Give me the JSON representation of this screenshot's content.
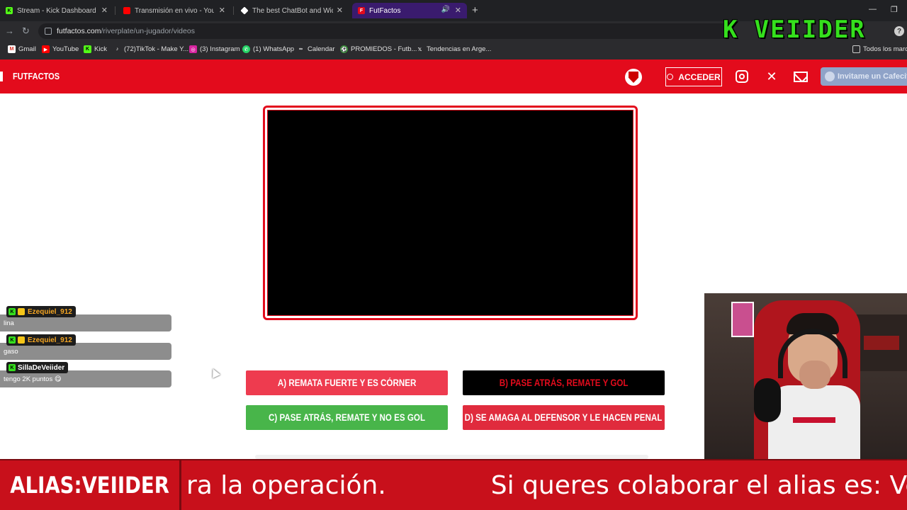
{
  "browser": {
    "tabs": [
      {
        "label": "Stream - Kick Dashboard",
        "icon": "kick-icon",
        "color": "#53fc18"
      },
      {
        "label": "Transmisión en vivo - YouTube",
        "icon": "youtube-icon",
        "color": "#ff0000"
      },
      {
        "label": "The best ChatBot and Widgets",
        "icon": "diamond-icon",
        "color": "#ffffff"
      },
      {
        "label": "FutFactos",
        "icon": "futfactos-icon",
        "color": "#e30b1c",
        "active": true
      }
    ],
    "url_domain": "futfactos.com",
    "url_path": "/riverplate/un-jugador/videos",
    "bookmarks": [
      {
        "label": "Gmail",
        "icon": "gmail-icon"
      },
      {
        "label": "YouTube",
        "icon": "youtube-icon"
      },
      {
        "label": "Kick",
        "icon": "kick-icon"
      },
      {
        "label": "(72)TikTok - Make Y...",
        "icon": "tiktok-icon"
      },
      {
        "label": "(3) Instagram",
        "icon": "instagram-icon"
      },
      {
        "label": "(1) WhatsApp",
        "icon": "whatsapp-icon"
      },
      {
        "label": "Calendar",
        "icon": "calendar-icon"
      },
      {
        "label": "PROMIEDOS - Futb...",
        "icon": "promiedos-icon"
      },
      {
        "label": "Tendencias en Arge...",
        "icon": "x-icon"
      }
    ],
    "all_bookmarks": "Todos los marca"
  },
  "overlay_logo": {
    "k": "K",
    "name": "VEIIDER"
  },
  "site": {
    "title": "FUTFACTOS",
    "login_label": "ACCEDER",
    "coffee_label": "Invitame un Cafecit",
    "accent": "#e30b1c"
  },
  "answers": [
    {
      "label": "A) REMATA FUERTE Y ES CÓRNER",
      "color": "#ee3b4f"
    },
    {
      "label": "B) PASE ATRÁS, REMATE Y GOL",
      "color": "#000000"
    },
    {
      "label": "C) PASE ATRÁS, REMATE Y NO ES GOL",
      "color": "#48b54a"
    },
    {
      "label": "D) SE AMAGA AL DEFENSOR Y LE HACEN PENAL",
      "color": "#e02b3d"
    }
  ],
  "chat": [
    {
      "user": "Ezequiel_912",
      "user_color": "#f5a623",
      "text": "lina"
    },
    {
      "user": "Ezequiel_912",
      "user_color": "#f5a623",
      "text": "gaso"
    },
    {
      "user": "SillaDeVeiider",
      "user_color": "#ffffff",
      "text": "tengo 2K puntos 😋"
    }
  ],
  "ticker": {
    "label": "ALIAS:VEIIDER",
    "text_1": "ra la operación.",
    "text_2": "Si queres colaborar el alias es: Vei"
  }
}
